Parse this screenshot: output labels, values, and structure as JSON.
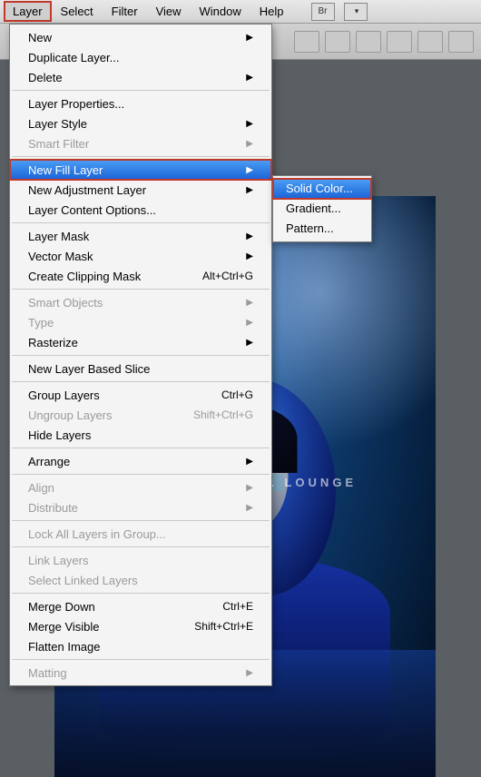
{
  "menubar": {
    "items": [
      "Layer",
      "Select",
      "Filter",
      "View",
      "Window",
      "Help"
    ],
    "active_index": 0
  },
  "layer_menu": {
    "groups": [
      [
        {
          "label": "New",
          "submenu": true
        },
        {
          "label": "Duplicate Layer..."
        },
        {
          "label": "Delete",
          "submenu": true
        }
      ],
      [
        {
          "label": "Layer Properties..."
        },
        {
          "label": "Layer Style",
          "submenu": true
        },
        {
          "label": "Smart Filter",
          "submenu": true,
          "disabled": true
        }
      ],
      [
        {
          "label": "New Fill Layer",
          "submenu": true,
          "highlighted": true
        },
        {
          "label": "New Adjustment Layer",
          "submenu": true
        },
        {
          "label": "Layer Content Options..."
        }
      ],
      [
        {
          "label": "Layer Mask",
          "submenu": true
        },
        {
          "label": "Vector Mask",
          "submenu": true
        },
        {
          "label": "Create Clipping Mask",
          "shortcut": "Alt+Ctrl+G"
        }
      ],
      [
        {
          "label": "Smart Objects",
          "submenu": true,
          "disabled": true
        },
        {
          "label": "Type",
          "submenu": true,
          "disabled": true
        },
        {
          "label": "Rasterize",
          "submenu": true
        }
      ],
      [
        {
          "label": "New Layer Based Slice"
        }
      ],
      [
        {
          "label": "Group Layers",
          "shortcut": "Ctrl+G"
        },
        {
          "label": "Ungroup Layers",
          "shortcut": "Shift+Ctrl+G",
          "disabled": true
        },
        {
          "label": "Hide Layers"
        }
      ],
      [
        {
          "label": "Arrange",
          "submenu": true
        }
      ],
      [
        {
          "label": "Align",
          "submenu": true,
          "disabled": true
        },
        {
          "label": "Distribute",
          "submenu": true,
          "disabled": true
        }
      ],
      [
        {
          "label": "Lock All Layers in Group...",
          "disabled": true
        }
      ],
      [
        {
          "label": "Link Layers",
          "disabled": true
        },
        {
          "label": "Select Linked Layers",
          "disabled": true
        }
      ],
      [
        {
          "label": "Merge Down",
          "shortcut": "Ctrl+E"
        },
        {
          "label": "Merge Visible",
          "shortcut": "Shift+Ctrl+E"
        },
        {
          "label": "Flatten Image"
        }
      ],
      [
        {
          "label": "Matting",
          "submenu": true,
          "disabled": true
        }
      ]
    ]
  },
  "new_fill_layer_submenu": {
    "items": [
      {
        "label": "Solid Color...",
        "highlighted": true
      },
      {
        "label": "Gradient..."
      },
      {
        "label": "Pattern..."
      }
    ]
  },
  "watermark": {
    "part1": "TUTORIAL",
    "part2": "LOUNGE"
  },
  "menubar_icons": {
    "br": "Br"
  }
}
